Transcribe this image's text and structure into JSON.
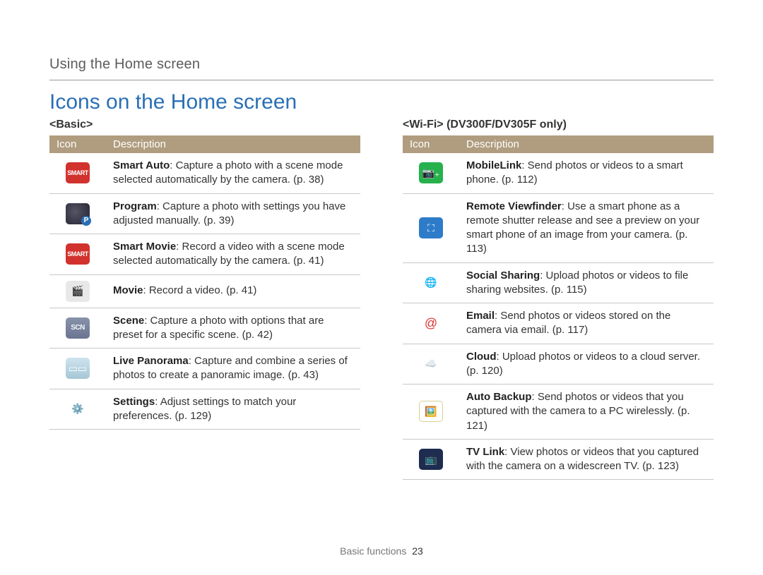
{
  "breadcrumb": "Using the Home screen",
  "title": "Icons on the Home screen",
  "footer": {
    "section": "Basic functions",
    "page": "23"
  },
  "cols": {
    "left": {
      "subhead": "<Basic>",
      "th_icon": "Icon",
      "th_desc": "Description",
      "rows": [
        {
          "icon": "smart-auto-icon",
          "glyph": "SMART",
          "cls": "ic-smart-auto",
          "bold": "Smart Auto",
          "rest": ": Capture a photo with a scene mode selected automatically by the camera. (p. 38)"
        },
        {
          "icon": "program-icon",
          "glyph": "",
          "cls": "ic-program",
          "bold": "Program",
          "rest": ": Capture a photo with settings you have adjusted manually. (p. 39)"
        },
        {
          "icon": "smart-movie-icon",
          "glyph": "SMART",
          "cls": "ic-smart-movie",
          "bold": "Smart Movie",
          "rest": ": Record a video with a scene mode selected automatically by the camera. (p. 41)"
        },
        {
          "icon": "movie-icon",
          "glyph": "🎬",
          "cls": "ic-movie",
          "bold": "Movie",
          "rest": ": Record a video. (p. 41)"
        },
        {
          "icon": "scene-icon",
          "glyph": "SCN",
          "cls": "ic-scene",
          "bold": "Scene",
          "rest": ": Capture a photo with options that are preset for a specific scene. (p. 42)"
        },
        {
          "icon": "panorama-icon",
          "glyph": "▭▭",
          "cls": "ic-panorama",
          "bold": "Live Panorama",
          "rest": ": Capture and combine a series of photos to create a panoramic image. (p. 43)"
        },
        {
          "icon": "settings-icon",
          "glyph": "⚙️",
          "cls": "ic-settings",
          "bold": "Settings",
          "rest": ": Adjust settings to match your preferences. (p. 129)"
        }
      ]
    },
    "right": {
      "subhead": "<Wi-Fi> (DV300F/DV305F only)",
      "th_icon": "Icon",
      "th_desc": "Description",
      "rows": [
        {
          "icon": "mobilelink-icon",
          "glyph": "📷₊",
          "cls": "ic-mobilelink",
          "bold": "MobileLink",
          "rest": ": Send photos or videos to a smart phone. (p. 112)"
        },
        {
          "icon": "remote-viewfinder-icon",
          "glyph": "⛶",
          "cls": "ic-remote",
          "bold": "Remote Viewfinder",
          "rest": ": Use a smart phone as a remote shutter release and see a preview on your smart phone of an image from your camera. (p. 113)"
        },
        {
          "icon": "social-sharing-icon",
          "glyph": "🌐",
          "cls": "ic-social",
          "bold": "Social Sharing",
          "rest": ": Upload photos or videos to file sharing websites. (p. 115)"
        },
        {
          "icon": "email-icon",
          "glyph": "@",
          "cls": "ic-email",
          "bold": "Email",
          "rest": ": Send photos or videos stored on the camera via email. (p. 117)"
        },
        {
          "icon": "cloud-icon",
          "glyph": "☁️",
          "cls": "ic-cloud",
          "bold": "Cloud",
          "rest": ": Upload photos or videos to a cloud server. (p. 120)"
        },
        {
          "icon": "auto-backup-icon",
          "glyph": "🖼️",
          "cls": "ic-backup",
          "bold": "Auto Backup",
          "rest": ": Send photos or videos that you captured with the camera to a PC wirelessly. (p. 121)"
        },
        {
          "icon": "tv-link-icon",
          "glyph": "📺",
          "cls": "ic-tvlink",
          "bold": "TV Link",
          "rest": ": View photos or videos that you captured with the camera on a widescreen TV. (p. 123)"
        }
      ]
    }
  }
}
